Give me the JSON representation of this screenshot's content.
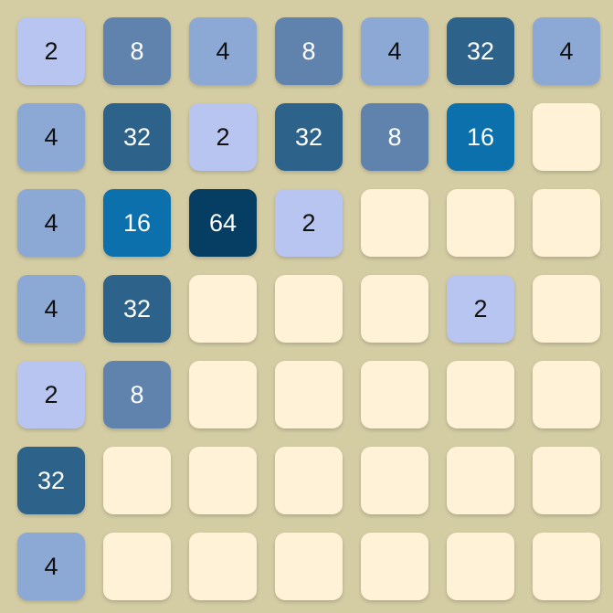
{
  "board": {
    "size": 7,
    "cells": [
      [
        2,
        8,
        4,
        8,
        4,
        32,
        4
      ],
      [
        4,
        32,
        2,
        32,
        8,
        16,
        0
      ],
      [
        4,
        16,
        64,
        2,
        0,
        0,
        0
      ],
      [
        4,
        32,
        0,
        0,
        0,
        2,
        0
      ],
      [
        2,
        8,
        0,
        0,
        0,
        0,
        0
      ],
      [
        32,
        0,
        0,
        0,
        0,
        0,
        0
      ],
      [
        4,
        0,
        0,
        0,
        0,
        0,
        0
      ]
    ]
  },
  "colors": {
    "background": "#d4cda4",
    "empty": "#fff2d6",
    "tile_2": "#b7c5f0",
    "tile_4": "#8ca8d4",
    "tile_8": "#6083ae",
    "tile_16": "#0c70ad",
    "tile_32": "#2d638a",
    "tile_64": "#053d63",
    "text_dark": "#111111",
    "text_light": "#ffffff"
  }
}
